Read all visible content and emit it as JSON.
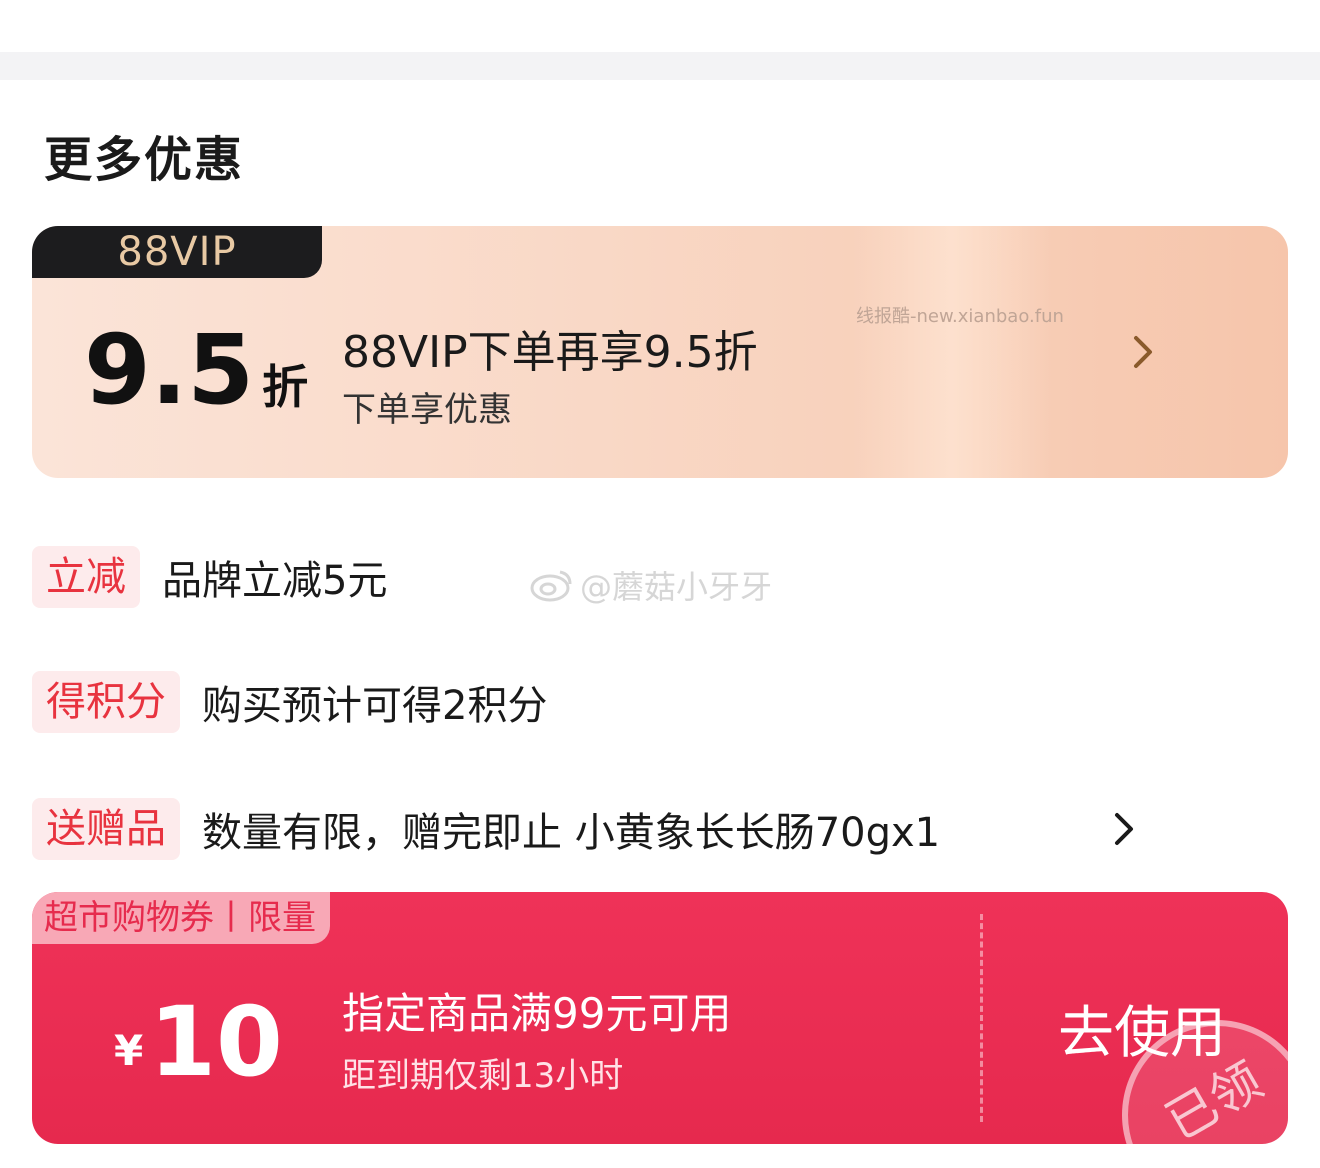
{
  "section_title": "更多优惠",
  "vip": {
    "badge": "88VIP",
    "discount_value": "9.5",
    "discount_unit": "折",
    "title": "88VIP下单再享9.5折",
    "subtitle": "下单享优惠",
    "watermark": "线报酷-new.xianbao.fun",
    "arrow_icon": "chevron-right-icon"
  },
  "benefits": [
    {
      "tag": "立减",
      "text": "品牌立减5元"
    },
    {
      "tag": "得积分",
      "text": "购买预计可得2积分"
    },
    {
      "tag": "送赠品",
      "text": "数量有限，赠完即止 小黄象长长肠70gx1",
      "arrow_icon": "chevron-right-icon"
    }
  ],
  "weibo_watermark": "@蘑菇小牙牙",
  "coupon": {
    "tag": "超市购物券丨限量",
    "currency": "¥",
    "amount": "10",
    "condition": "指定商品满99元可用",
    "expiry": "距到期仅剩13小时",
    "action": "去使用",
    "stamp": "已领"
  },
  "colors": {
    "accent_red": "#e6294e",
    "tag_red": "#e8333f",
    "vip_gold": "#e8c9a4"
  }
}
